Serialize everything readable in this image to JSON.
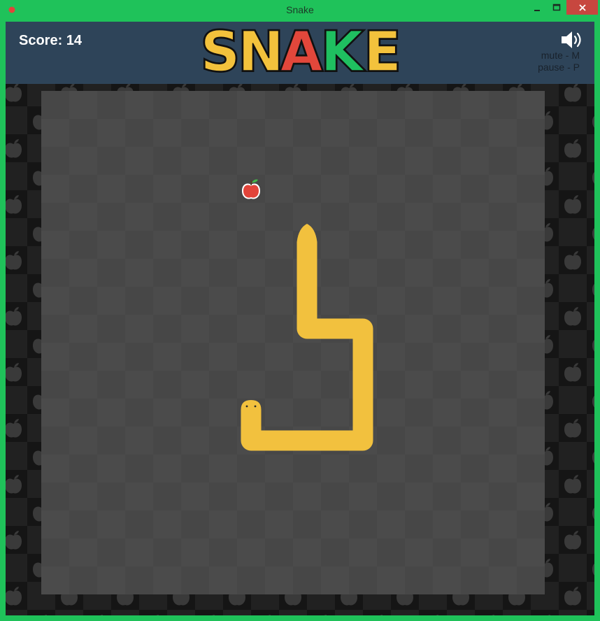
{
  "window": {
    "title": "Snake",
    "controls": [
      "minimize",
      "maximize",
      "close"
    ]
  },
  "header": {
    "score_text": "Score: 14",
    "logo_text": "SNAKE",
    "logo_letter_colors": [
      "#f3c23c",
      "#f3c23c",
      "#e2473b",
      "#1fbf60",
      "#f3c23c"
    ],
    "mute_hint": "mute - M",
    "pause_hint": "pause - P",
    "sound_icon": "speaker-on-icon"
  },
  "game": {
    "score": 14,
    "grid_cols": 18,
    "grid_rows": 18,
    "food": {
      "col": 7,
      "row": 3,
      "icon": "apple-icon"
    },
    "snake_head": {
      "col": 7,
      "row": 11,
      "facing": "up"
    },
    "snake_tail": {
      "col": 9,
      "row": 5,
      "facing": "up"
    },
    "snake_path": [
      [
        7,
        11
      ],
      [
        7,
        12
      ],
      [
        8,
        12
      ],
      [
        9,
        12
      ],
      [
        10,
        12
      ],
      [
        11,
        12
      ],
      [
        11,
        11
      ],
      [
        11,
        10
      ],
      [
        11,
        9
      ],
      [
        11,
        8
      ],
      [
        10,
        8
      ],
      [
        9,
        8
      ],
      [
        9,
        7
      ],
      [
        9,
        6
      ],
      [
        9,
        5
      ]
    ],
    "colors": {
      "snake": "#f2c13e",
      "field": "#4b4b4b",
      "border": "#1b1b1b",
      "header": "#2e4459",
      "window_frame": "#1fc25a",
      "apple": "#e2443a",
      "leaf": "#43b54a"
    }
  }
}
